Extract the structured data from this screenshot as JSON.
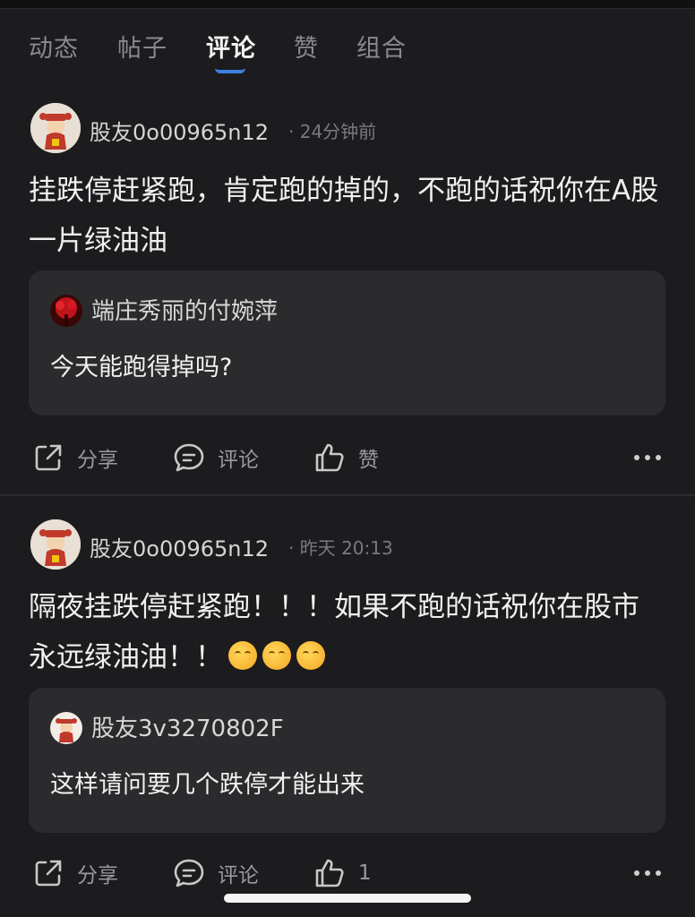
{
  "tabs": [
    {
      "label": "动态"
    },
    {
      "label": "帖子"
    },
    {
      "label": "评论"
    },
    {
      "label": "赞"
    },
    {
      "label": "组合"
    }
  ],
  "active_tab": "评论",
  "posts": [
    {
      "author": "股友0o00965n12",
      "time": "24分钟前",
      "body": "挂跌停赶紧跑，肯定跑的掉的，不跑的话祝你在A股一片绿油油",
      "quote": {
        "author": "端庄秀丽的付婉萍",
        "text": "今天能跑得掉吗?"
      },
      "actions": {
        "share": "分享",
        "comment": "评论",
        "like": "赞"
      }
    },
    {
      "author": "股友0o00965n12",
      "time": "昨天 20:13",
      "body": "隔夜挂跌停赶紧跑！！！如果不跑的话祝你在股市永远绿油油！！",
      "emoji": [
        "laughing-face-icon",
        "laughing-face-icon",
        "laughing-face-icon"
      ],
      "quote": {
        "author": "股友3v3270802F",
        "text": "这样请问要几个跌停才能出来"
      },
      "actions": {
        "share": "分享",
        "comment": "评论",
        "like": "1"
      }
    }
  ],
  "colors": {
    "background": "#1c1c1e",
    "card": "#2b2b2e",
    "accent": "#3d7fe0"
  }
}
